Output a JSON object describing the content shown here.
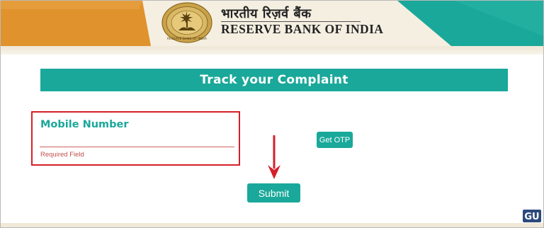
{
  "header": {
    "logo_hindi": "भारतीय रिज़र्व बैंक",
    "logo_english": "RESERVE BANK OF INDIA",
    "colors": {
      "orange": "#e0922d",
      "teal": "#1aa89a",
      "cream": "#f5efe2"
    }
  },
  "page": {
    "title": "Track your Complaint"
  },
  "form": {
    "mobile_label": "Mobile Number",
    "mobile_value": "",
    "mobile_hint": "Required Field",
    "otp_button": "Get OTP",
    "submit_button": "Submit"
  },
  "annotations": {
    "highlight_color": "#d4202a",
    "arrow_icon": "down-arrow-icon"
  },
  "watermark": {
    "icon": "gadgets-to-use-logo-icon"
  }
}
